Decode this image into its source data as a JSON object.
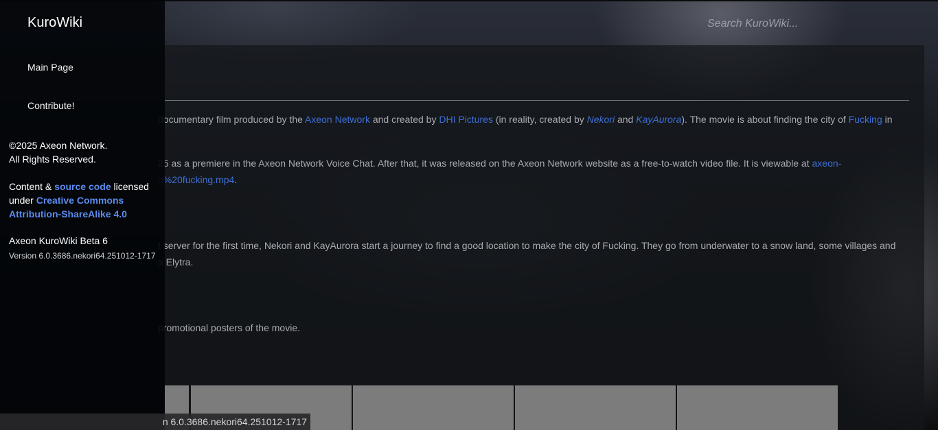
{
  "header": {
    "search_placeholder": "Search KuroWiki..."
  },
  "sidebar": {
    "brand": "KuroWiki",
    "nav": [
      {
        "label": "Main Page"
      },
      {
        "label": "Contribute!"
      }
    ],
    "copyright_line1": "©2025 Axeon Network.",
    "copyright_line2": "All Rights Reserved.",
    "license": {
      "prefix": "Content & ",
      "source_link": "source code",
      "mid": " licensed",
      "under": "under ",
      "cc_link_line1": "Creative Commons",
      "cc_link_line2": "Attribution-ShareAlike 4.0"
    },
    "build_name": "Axeon KuroWiki Beta 6",
    "version": "Version 6.0.3686.nekori64.251012-1717"
  },
  "article": {
    "p1": {
      "t1": " documentary film produced by the ",
      "l1": "Axeon Network",
      "t2": " and created by ",
      "l2": "DHI Pictures",
      "t3": " (in reality, created by ",
      "l3": "Nekori",
      "t4": " and ",
      "l4": "KayAurora",
      "t5": "). The movie is about finding the city of ",
      "l5": "Fucking",
      "t6": " in"
    },
    "p2": {
      "line1_text": "25 as a premiere in the Axeon Network Voice Chat. After that, it was released on the Axeon Network website as a free-to-watch video file. It is viewable at ",
      "line1_link": "axeon-",
      "line2_link": "g%20fucking.mp4",
      "line2_end": "."
    },
    "p3": {
      "line1": "t server for the first time, Nekori and KayAurora start a journey to find a good location to make the city of Fucking. They go from underwater to a snow land, some villages and",
      "line2": "a Elytra."
    },
    "p4": " promotional posters of the movie."
  },
  "status_bar": {
    "text": "n 6.0.3686.nekori64.251012-1717"
  }
}
